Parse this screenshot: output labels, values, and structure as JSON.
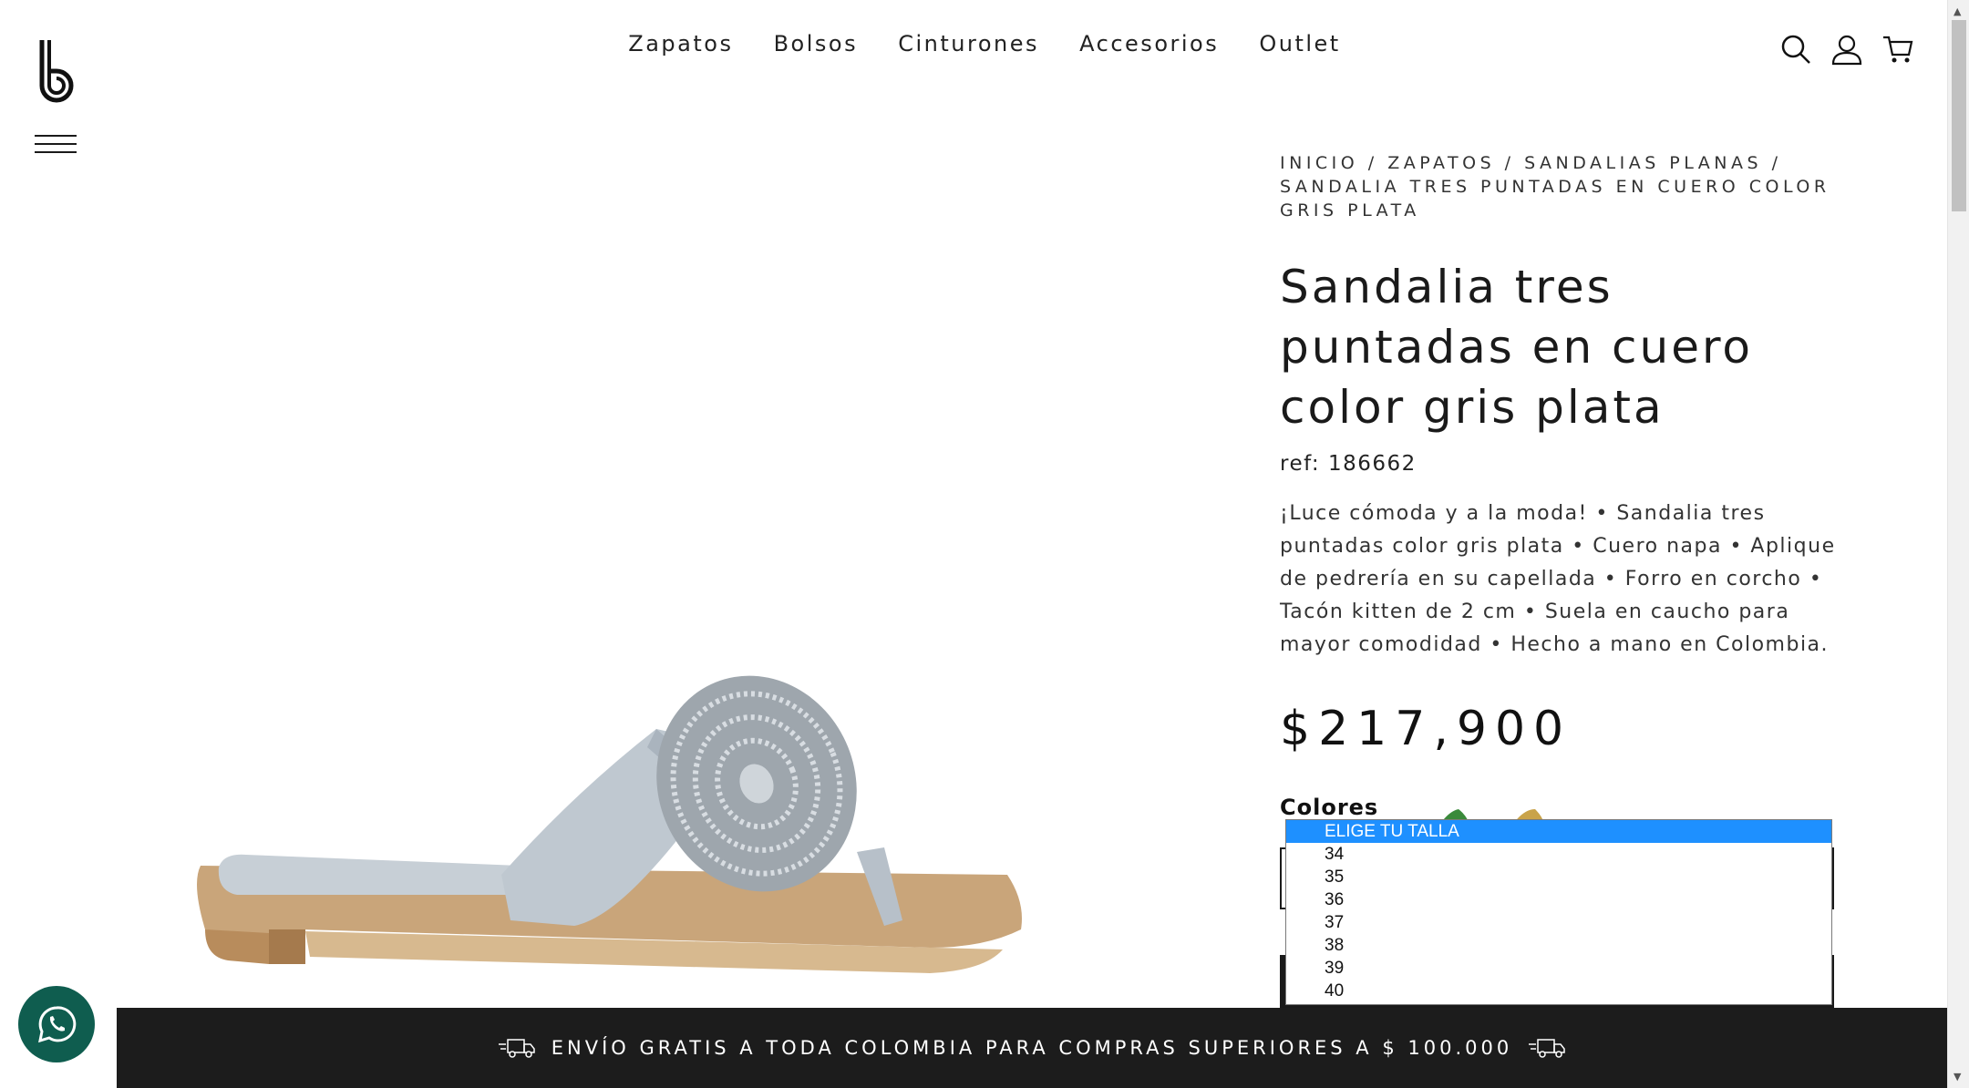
{
  "nav": {
    "items": [
      "Zapatos",
      "Bolsos",
      "Cinturones",
      "Accesorios",
      "Outlet"
    ]
  },
  "icons": {
    "logo": "b-logo-icon",
    "menu": "hamburger-icon",
    "search": "search-icon",
    "user": "user-icon",
    "cart": "cart-icon",
    "whatsapp": "whatsapp-icon",
    "truck": "truck-icon"
  },
  "product": {
    "breadcrumb": "INICIO / ZAPATOS / SANDALIAS PLANAS / SANDALIA TRES PUNTADAS EN CUERO COLOR GRIS PLATA",
    "title": "Sandalia tres puntadas en cuero color gris plata",
    "ref": "ref: 186662",
    "description": "¡Luce cómoda y a la moda! • Sandalia tres puntadas color gris plata • Cuero napa • Aplique de pedrería en su capellada • Forro en corcho • Tacón kitten de 2 cm • Suela en caucho para mayor comodidad • Hecho a mano en Colombia.",
    "price": "$217,900",
    "colors_label": "Colores"
  },
  "size_dropdown": {
    "options": [
      "ELIGE TU TALLA",
      "34",
      "35",
      "36",
      "37",
      "38",
      "39",
      "40"
    ],
    "selected": "ELIGE TU TALLA"
  },
  "banner": {
    "text": "ENVÍO GRATIS A TODA COLOMBIA PARA COMPRAS SUPERIORES A $ 100.000"
  },
  "colors": {
    "banner_bg": "#1c1c1c",
    "whatsapp_bg": "#0f5d4f",
    "dropdown_selected": "#1e90ff"
  }
}
